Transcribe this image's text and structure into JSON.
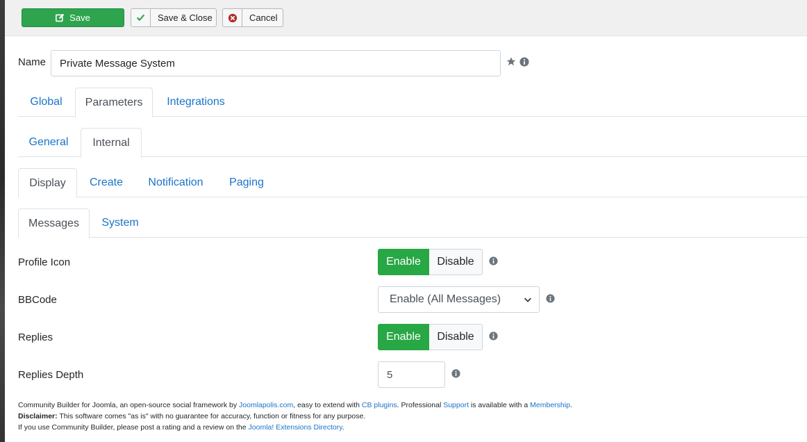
{
  "toolbar": {
    "save_label": "Save",
    "save_close_label": "Save & Close",
    "cancel_label": "Cancel"
  },
  "name_field": {
    "label": "Name",
    "value": "Private Message System"
  },
  "tabs_level1": [
    "Global",
    "Parameters",
    "Integrations"
  ],
  "tabs_level2": [
    "General",
    "Internal"
  ],
  "tabs_level3": [
    "Display",
    "Create",
    "Notification",
    "Paging"
  ],
  "tabs_level4": [
    "Messages",
    "System"
  ],
  "fields": {
    "profile_icon": {
      "label": "Profile Icon",
      "enable": "Enable",
      "disable": "Disable"
    },
    "bbcode": {
      "label": "BBCode",
      "selected": "Enable (All Messages)"
    },
    "replies": {
      "label": "Replies",
      "enable": "Enable",
      "disable": "Disable"
    },
    "replies_depth": {
      "label": "Replies Depth",
      "value": "5"
    }
  },
  "footer": {
    "line1_a": "Community Builder for Joomla, an open-source social framework by ",
    "link_joomlapolis": "Joomlapolis.com",
    "line1_b": ", easy to extend with ",
    "link_cb_plugins": "CB plugins",
    "line1_c": ". Professional ",
    "link_support": "Support",
    "line1_d": " is available with a ",
    "link_membership": "Membership",
    "line1_e": ".",
    "disclaimer_label": "Disclaimer:",
    "disclaimer_text": " This software comes \"as is\" with no guarantee for accuracy, function or fitness for any purpose.",
    "line3_a": "If you use Community Builder, please post a rating and a review on the ",
    "link_jed": "Joomla! Extensions Directory",
    "line3_b": "."
  },
  "colors": {
    "success_green": "#28a745",
    "link_blue": "#1a73c9",
    "cancel_red": "#b52b27"
  },
  "icons": [
    "edit-icon",
    "check-icon",
    "cancel-circle-icon",
    "star-icon",
    "info-icon",
    "chevron-down-icon"
  ]
}
